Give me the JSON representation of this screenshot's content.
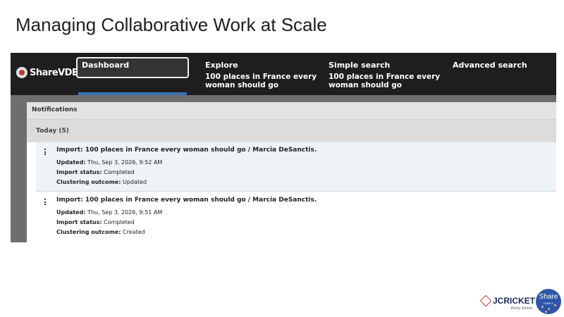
{
  "slide": {
    "title": "Managing Collaborative Work at Scale"
  },
  "app": {
    "logo": "ShareVDE",
    "nav": [
      {
        "title": "Dashboard",
        "subtitle": ""
      },
      {
        "title": "Explore",
        "subtitle": "100 places in France every woman should go"
      },
      {
        "title": "Simple search",
        "subtitle": "100 places in France every woman should go"
      },
      {
        "title": "Advanced search",
        "subtitle": ""
      }
    ],
    "notifications": {
      "header": "Notifications",
      "group": "Today (5)",
      "items": [
        {
          "title": "Import: 100 places in France every woman should go / Marcia DeSanctis.",
          "updated_label": "Updated:",
          "updated": "Thu, Sep 3, 2026, 9:52 AM",
          "status_label": "Import status:",
          "status": "Completed",
          "clustering_label": "Clustering outcome:",
          "clustering": "Updated"
        },
        {
          "title": "Import: 100 places in France every woman should go / Marcia DeSanctis.",
          "updated_label": "Updated:",
          "updated": "Thu, Sep 3, 2026, 9:51 AM",
          "status_label": "Import status:",
          "status": "Completed",
          "clustering_label": "Clustering outcome:",
          "clustering": "Created"
        }
      ]
    }
  },
  "footer": {
    "jcricket": "JCRICKET",
    "jcricket_sub": "Emily Kirkov",
    "share_badge": "Share",
    "share_family": "FAMILY"
  },
  "colors": {
    "nav_bg": "#1e1e1e",
    "accent": "#3a6fb5",
    "brand_red": "#c0392b",
    "share_blue": "#2d55a8"
  }
}
